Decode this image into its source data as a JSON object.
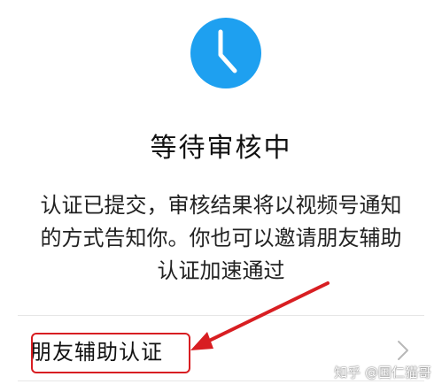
{
  "status": {
    "icon": "clock-icon",
    "icon_color": "#1ea0f0",
    "title": "等待审核中",
    "message_lines": [
      "认证已提交，审核结果将以视频号通知",
      "的方式告知你。你也可以邀请朋友辅助",
      "认证加速通过"
    ]
  },
  "assist": {
    "label": "朋友辅助认证",
    "chevron_icon": "chevron-right-icon",
    "highlight_color": "#d81e22"
  },
  "annotation": {
    "arrow_icon": "red-arrow-annotation",
    "color": "#d81e22"
  },
  "watermark": {
    "text": "知乎 @国仁猫哥"
  }
}
